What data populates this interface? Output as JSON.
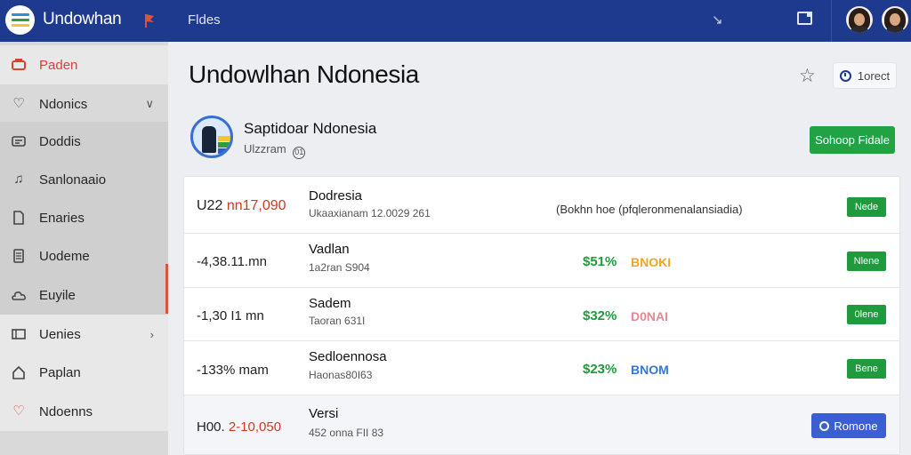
{
  "app": {
    "title": "Undowhan",
    "top_tab": "Fldes",
    "logo_colors": [
      "#2e8fd6",
      "#2c9c46",
      "#f3c531"
    ]
  },
  "sidebar": {
    "items": [
      {
        "label": "Paden",
        "icon": "warning-icon",
        "active": true
      },
      {
        "label": "Ndonics",
        "icon": "heart-outline-icon",
        "chevron": "∨"
      },
      {
        "label": "Doddis",
        "icon": "message-icon"
      },
      {
        "label": "Sanlonaaio",
        "icon": "music-note-icon"
      },
      {
        "label": "Enaries",
        "icon": "document-icon"
      },
      {
        "label": "Uodeme",
        "icon": "list-document-icon"
      },
      {
        "label": "Euyile",
        "icon": "cloud-icon"
      },
      {
        "label": "Uenies",
        "icon": "table-icon",
        "chevron": "›"
      },
      {
        "label": "Paplan",
        "icon": "home-icon"
      },
      {
        "label": "Ndoenns",
        "icon": "heart-icon"
      }
    ]
  },
  "main": {
    "page_title": "Undowlhan Ndonesia",
    "info_button": "1orect",
    "profile": {
      "name": "Saptidoar Ndonesia",
      "subtitle": "Ulzzram",
      "badge": "01"
    },
    "primary_button": "Sohoop Fidale"
  },
  "table": {
    "rows": [
      {
        "left_prefix": "U22",
        "left_value": "nn17,090",
        "title": "Dodresia",
        "sub": "Ukaaxianam 12.0029 261",
        "note": "(Bokhn hoe (pfqleronmenalansiadia)",
        "button": "Nede"
      },
      {
        "left_prefix": "-4,38.11.mn",
        "title": "Vadlan",
        "sub": "1a2ran S904",
        "pct": "$51%",
        "tag": "BNOKI",
        "tag_color": "#f0a61c",
        "button": "Nlene"
      },
      {
        "left_prefix": "-1,30 I1 mn",
        "title": "Sadem",
        "sub": "Taoran 631I",
        "pct": "$32%",
        "tag": "D0NAI",
        "tag_color": "#e08a93",
        "button": "0lene"
      },
      {
        "left_prefix": "-133% mam",
        "title": "Sedloennosa",
        "sub": "Haonas80I63",
        "pct": "$23%",
        "tag": "BNOM",
        "tag_color": "#3478d4",
        "button": "Bene"
      },
      {
        "left_prefix": "H00.",
        "left_value": "2-10,050",
        "title": "Versi",
        "sub": "452 onna FII 83",
        "button": "Romone"
      }
    ]
  }
}
